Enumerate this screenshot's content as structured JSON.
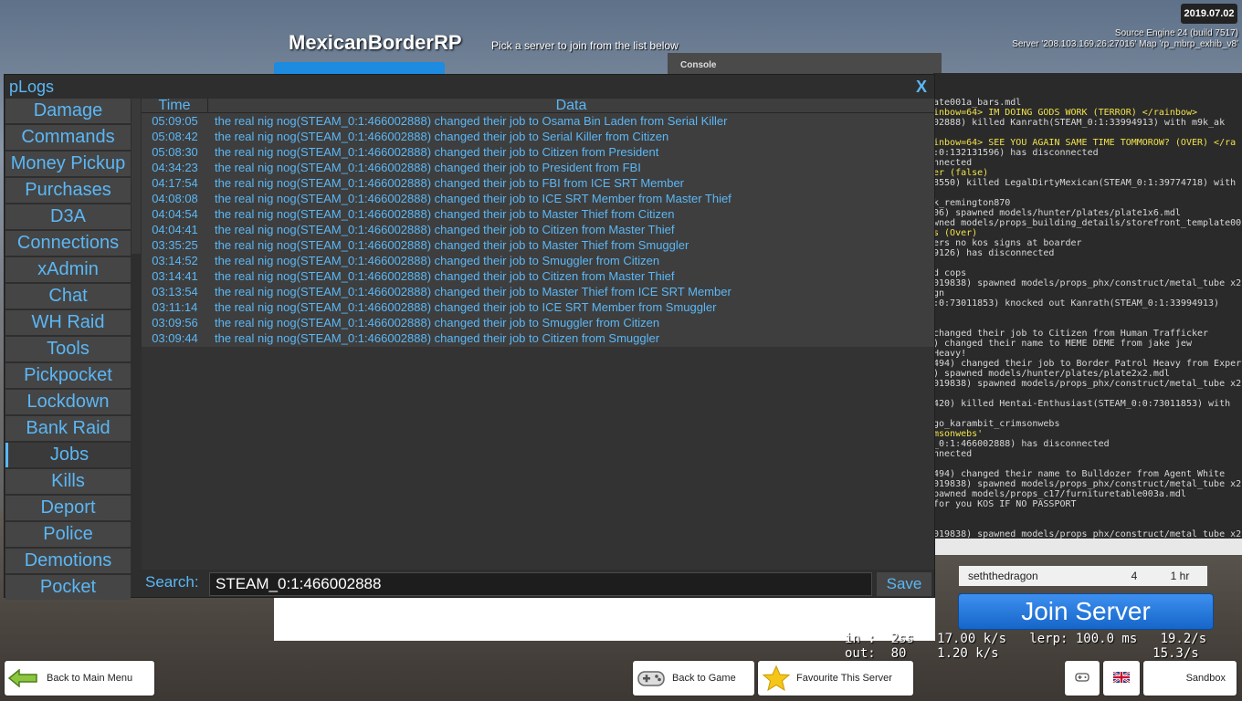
{
  "server": {
    "title": "MexicanBorderRP",
    "subtitle": "Pick a server to join from the list below",
    "date": "2019.07.02",
    "engine": "Source Engine 24 (build 7517)",
    "address": "Server '208.103.169.26:27016' Map 'rp_mbrp_exhib_v8'",
    "console_tab": "Console"
  },
  "console_lines": [
    {
      "text": "ate001a_bars.mdl",
      "color": "white"
    },
    {
      "text": "inbow=64> IM DOING GODS WORK (TERROR)  </rainbow>",
      "color": "yellow"
    },
    {
      "text": "02888) killed Kanrath(STEAM_0:1:33994913) with m9k_ak",
      "color": "white"
    },
    {
      "text": "",
      "color": "white"
    },
    {
      "text": "inbow=64> SEE YOU AGAIN SAME TIME TOMMOROW? (OVER)  </ra",
      "color": "yellow"
    },
    {
      "text": ":0:132131596) has disconnected",
      "color": "white"
    },
    {
      "text": "nnected",
      "color": "white"
    },
    {
      "text": "er (false)",
      "color": "yellow"
    },
    {
      "text": "8550) killed LegalDirtyMexican(STEAM_0:1:39774718) with",
      "color": "white"
    },
    {
      "text": "",
      "color": "white"
    },
    {
      "text": "k_remington870",
      "color": "white"
    },
    {
      "text": "06) spawned models/hunter/plates/plate1x6.mdl",
      "color": "white"
    },
    {
      "text": "wned models/props_building_details/storefront_template00",
      "color": "white"
    },
    {
      "text": "s (Over)",
      "color": "yellow"
    },
    {
      "text": "ers no kos signs at boarder",
      "color": "white"
    },
    {
      "text": "9126) has disconnected",
      "color": "white"
    },
    {
      "text": "",
      "color": "white"
    },
    {
      "text": "d cops",
      "color": "white"
    },
    {
      "text": "019838) spawned models/props_phx/construct/metal_tube x2.",
      "color": "white"
    },
    {
      "text": "gn",
      "color": "white"
    },
    {
      "text": ":0:73011853) knocked out Kanrath(STEAM_0:1:33994913)",
      "color": "white"
    },
    {
      "text": "",
      "color": "white"
    },
    {
      "text": "",
      "color": "white"
    },
    {
      "text": " changed their job to Citizen from Human Trafficker",
      "color": "white"
    },
    {
      "text": ") changed their name to MEME DEME from jake jew",
      "color": "white"
    },
    {
      "text": " Heavy!",
      "color": "white"
    },
    {
      "text": "494) changed their job to Border Patrol Heavy from Expert",
      "color": "white"
    },
    {
      "text": ") spawned models/hunter/plates/plate2x2.mdl",
      "color": "white"
    },
    {
      "text": "019838) spawned models/props_phx/construct/metal_tube x2.",
      "color": "white"
    },
    {
      "text": "",
      "color": "white"
    },
    {
      "text": "420) killed Hentai-Enthusiast(STEAM_0:0:73011853) with",
      "color": "white"
    },
    {
      "text": "",
      "color": "white"
    },
    {
      "text": "go_karambit_crimsonwebs",
      "color": "white"
    },
    {
      "text": "msonwebs'",
      "color": "yellow"
    },
    {
      "text": "_0:1:466002888) has disconnected",
      "color": "white"
    },
    {
      "text": "nnected",
      "color": "white"
    },
    {
      "text": "",
      "color": "white"
    },
    {
      "text": "494) changed their name to Bulldozer from Agent White",
      "color": "white"
    },
    {
      "text": "019838) spawned models/props_phx/construct/metal_tube x2.",
      "color": "white"
    },
    {
      "text": "pawned models/props_c17/furnituretable003a.mdl",
      "color": "white"
    },
    {
      "text": " for you KOS IF NO PASSPORT",
      "color": "white"
    },
    {
      "text": "",
      "color": "white"
    },
    {
      "text": "",
      "color": "white"
    },
    {
      "text": "019838) spawned models/props_phx/construct/metal_tube x2.",
      "color": "white"
    }
  ],
  "player_row": {
    "name": "seththedragon",
    "score": "4",
    "time": "1 hr"
  },
  "join_label": "Join Server",
  "hud_lines": "in :  2ss   17.00 k/s   lerp: 100.0 ms   19.2/s\nout:  80    1.20 k/s                    15.3/s",
  "bottom": {
    "back_menu": "Back to Main Menu",
    "back_game": "Back to Game",
    "favourite": "Favourite This Server",
    "sandbox": "Sandbox"
  },
  "plogs": {
    "title": "pLogs",
    "close": "X",
    "sidebar": [
      "Damage",
      "Commands",
      "Money Pickup",
      "Purchases",
      "D3A",
      "Connections",
      "xAdmin",
      "Chat",
      "WH Raid",
      "Tools",
      "Pickpocket",
      "Lockdown",
      "Bank Raid",
      "Jobs",
      "Kills",
      "Deport",
      "Police",
      "Demotions",
      "Pocket"
    ],
    "active_index": 13,
    "col_time": "Time",
    "col_data": "Data",
    "rows": [
      {
        "time": "05:09:05",
        "data": "the real nig nog(STEAM_0:1:466002888) changed their job to Osama Bin Laden from Serial Killer"
      },
      {
        "time": "05:08:42",
        "data": "the real nig nog(STEAM_0:1:466002888) changed their job to Serial Killer from Citizen"
      },
      {
        "time": "05:08:30",
        "data": "the real nig nog(STEAM_0:1:466002888) changed their job to Citizen from President"
      },
      {
        "time": "04:34:23",
        "data": "the real nig nog(STEAM_0:1:466002888) changed their job to President from FBI"
      },
      {
        "time": "04:17:54",
        "data": "the real nig nog(STEAM_0:1:466002888) changed their job to FBI from ICE SRT Member"
      },
      {
        "time": "04:08:08",
        "data": "the real nig nog(STEAM_0:1:466002888) changed their job to ICE SRT Member from Master Thief"
      },
      {
        "time": "04:04:54",
        "data": "the real nig nog(STEAM_0:1:466002888) changed their job to Master Thief from Citizen"
      },
      {
        "time": "04:04:41",
        "data": "the real nig nog(STEAM_0:1:466002888) changed their job to Citizen from Master Thief"
      },
      {
        "time": "03:35:25",
        "data": "the real nig nog(STEAM_0:1:466002888) changed their job to Master Thief from Smuggler"
      },
      {
        "time": "03:14:52",
        "data": "the real nig nog(STEAM_0:1:466002888) changed their job to Smuggler from Citizen"
      },
      {
        "time": "03:14:41",
        "data": "the real nig nog(STEAM_0:1:466002888) changed their job to Citizen from Master Thief"
      },
      {
        "time": "03:13:54",
        "data": "the real nig nog(STEAM_0:1:466002888) changed their job to Master Thief from ICE SRT Member"
      },
      {
        "time": "03:11:14",
        "data": "the real nig nog(STEAM_0:1:466002888) changed their job to ICE SRT Member from Smuggler"
      },
      {
        "time": "03:09:56",
        "data": "the real nig nog(STEAM_0:1:466002888) changed their job to Smuggler from Citizen"
      },
      {
        "time": "03:09:44",
        "data": "the real nig nog(STEAM_0:1:466002888) changed their job to Citizen from Smuggler"
      }
    ],
    "search_label": "Search:",
    "search_value": "STEAM_0:1:466002888",
    "save_label": "Save"
  },
  "colors": {
    "accent": "#5bb7f5",
    "console_yellow": "#f2e24a",
    "join_blue": "#1d78e0"
  }
}
